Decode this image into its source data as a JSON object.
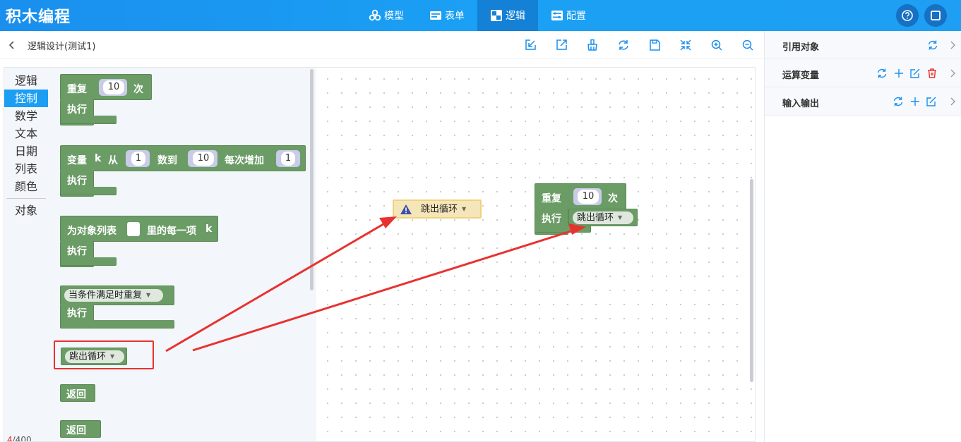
{
  "app": {
    "title": "积木编程"
  },
  "nav": [
    {
      "label": "模型",
      "icon": "cubes-icon"
    },
    {
      "label": "表单",
      "icon": "form-icon"
    },
    {
      "label": "逻辑",
      "icon": "puzzle-icon",
      "active": true
    },
    {
      "label": "配置",
      "icon": "settings-icon"
    }
  ],
  "header_buttons": {
    "help": "help-icon",
    "fullscreen": "fullscreen-icon"
  },
  "toolbar": {
    "title": "逻辑设计(测试1)",
    "tools": [
      "import-icon",
      "export-icon",
      "clear-icon",
      "refresh-icon",
      "save-icon",
      "collapse-icon",
      "zoom-in-icon",
      "zoom-out-icon"
    ]
  },
  "categories": [
    "逻辑",
    "控制",
    "数学",
    "文本",
    "日期",
    "列表",
    "颜色",
    "对象"
  ],
  "active_category": "控制",
  "counter": {
    "current": "4",
    "total": "/400"
  },
  "blocks": {
    "repeat": {
      "label": "重复",
      "value": "10",
      "suffix": "次",
      "do": "执行"
    },
    "for": {
      "label_var": "变量",
      "var": "k",
      "from": "从",
      "from_val": "1",
      "to": "数到",
      "to_val": "10",
      "step": "每次增加",
      "step_val": "1",
      "do": "执行"
    },
    "foreach": {
      "label": "为对象列表",
      "item": "里的每一项",
      "var": "k",
      "do": "执行"
    },
    "while": {
      "label": "当条件满足时重复",
      "do": "执行"
    },
    "break": {
      "label": "跳出循环"
    },
    "return1": {
      "label": "返回"
    },
    "return2": {
      "label": "返回"
    }
  },
  "canvas": {
    "floating_break": {
      "label": "跳出循环",
      "warning": "warning-icon"
    },
    "repeat": {
      "label": "重复",
      "value": "10",
      "suffix": "次",
      "do": "执行",
      "inner": "跳出循环"
    }
  },
  "right_panel": [
    {
      "label": "引用对象",
      "icons": [
        "refresh-icon"
      ]
    },
    {
      "label": "运算变量",
      "icons": [
        "refresh-icon",
        "plus-icon",
        "edit-icon",
        "delete-icon"
      ]
    },
    {
      "label": "输入输出",
      "icons": [
        "refresh-icon",
        "plus-icon",
        "edit-icon"
      ]
    }
  ],
  "colors": {
    "header": "#1a9bf0",
    "block": "#6b9c66",
    "callout": "#e8322f",
    "active_category": "#1c9ef2"
  }
}
